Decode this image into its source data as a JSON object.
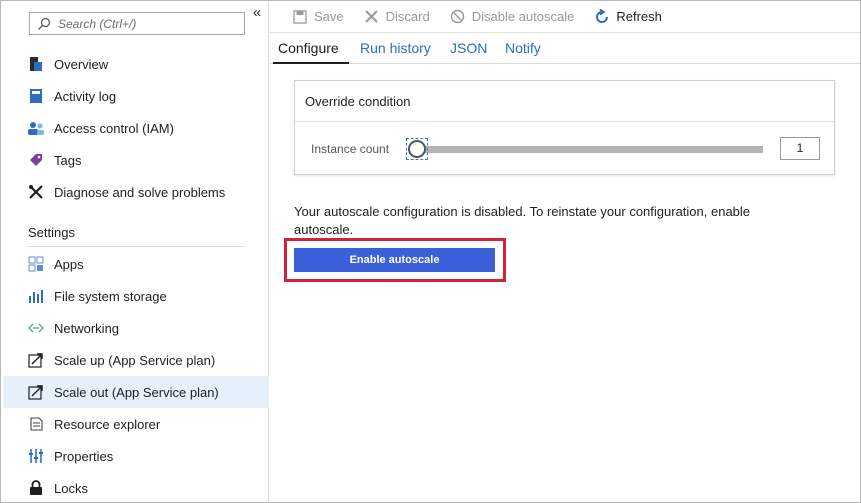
{
  "sidebar": {
    "search_placeholder": "Search (Ctrl+/)",
    "collapse_glyph": "«",
    "top_items": [
      {
        "label": "Overview",
        "icon": "overview-icon"
      },
      {
        "label": "Activity log",
        "icon": "activity-log-icon"
      },
      {
        "label": "Access control (IAM)",
        "icon": "access-control-icon"
      },
      {
        "label": "Tags",
        "icon": "tag-icon"
      },
      {
        "label": "Diagnose and solve problems",
        "icon": "tools-icon"
      }
    ],
    "settings_title": "Settings",
    "settings_items": [
      {
        "label": "Apps",
        "icon": "apps-icon"
      },
      {
        "label": "File system storage",
        "icon": "storage-chart-icon"
      },
      {
        "label": "Networking",
        "icon": "networking-icon"
      },
      {
        "label": "Scale up (App Service plan)",
        "icon": "scale-up-icon"
      },
      {
        "label": "Scale out (App Service plan)",
        "icon": "scale-out-icon",
        "selected": true
      },
      {
        "label": "Resource explorer",
        "icon": "resource-explorer-icon"
      },
      {
        "label": "Properties",
        "icon": "properties-icon"
      },
      {
        "label": "Locks",
        "icon": "lock-icon"
      }
    ]
  },
  "toolbar": {
    "save_label": "Save",
    "discard_label": "Discard",
    "disable_label": "Disable autoscale",
    "refresh_label": "Refresh"
  },
  "tabs": {
    "configure": "Configure",
    "run_history": "Run history",
    "json": "JSON",
    "notify": "Notify",
    "active": "Configure"
  },
  "override": {
    "title": "Override condition",
    "instance_label": "Instance count",
    "instance_value": "1"
  },
  "message": {
    "text": "Your autoscale configuration is disabled. To reinstate your configuration, enable autoscale.",
    "enable_button": "Enable autoscale"
  },
  "colors": {
    "accent": "#3b5fd8",
    "highlight": "#d1233c",
    "link": "#2e6cc0",
    "selected_bg": "#e6f0fa"
  }
}
